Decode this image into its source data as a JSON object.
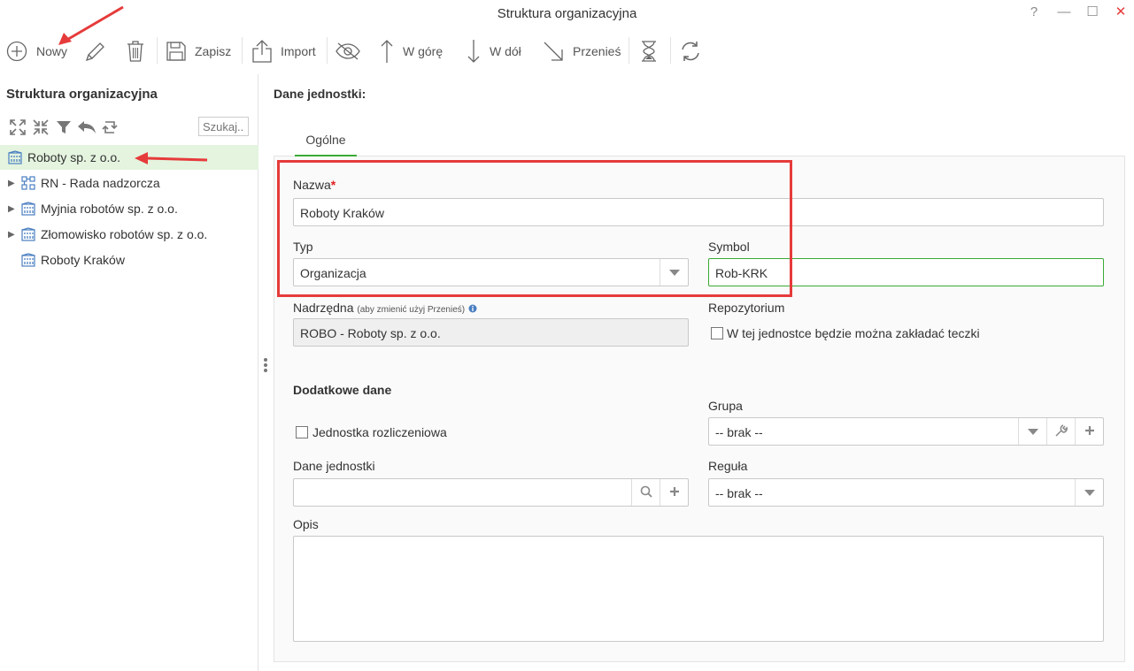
{
  "window": {
    "title": "Struktura organizacyjna",
    "help": "?",
    "minimize": "—",
    "maximize": "☐",
    "close": "✕"
  },
  "toolbar": {
    "new_label": "Nowy",
    "save_label": "Zapisz",
    "import_label": "Import",
    "up_label": "W górę",
    "down_label": "W dół",
    "move_label": "Przenieś"
  },
  "tree": {
    "title": "Struktura organizacyjna",
    "search_placeholder": "Szukaj...",
    "items": [
      {
        "label": "Roboty sp. z o.o.",
        "icon": "building-icon",
        "expandable": false,
        "selected": true
      },
      {
        "label": "RN - Rada nadzorcza",
        "icon": "org-chart-icon",
        "expandable": true
      },
      {
        "label": "Myjnia robotów sp. z o.o.",
        "icon": "building-icon",
        "expandable": true
      },
      {
        "label": "Złomowisko robotów sp. z o.o.",
        "icon": "building-icon",
        "expandable": true
      },
      {
        "label": "Roboty Kraków",
        "icon": "building-icon",
        "expandable": false
      }
    ]
  },
  "form": {
    "title": "Dane jednostki:",
    "tab": "Ogólne",
    "name_label": "Nazwa",
    "name_required": "*",
    "name_value": "Roboty Kraków",
    "type_label": "Typ",
    "type_value": "Organizacja",
    "symbol_label": "Symbol",
    "symbol_value": "Rob-KRK",
    "parent_label": "Nadrzędna",
    "parent_hint": "(aby zmienić użyj Przenieś)",
    "parent_value": "ROBO - Roboty sp. z o.o.",
    "repo_label": "Repozytorium",
    "repo_checkbox": "W tej jednostce będzie można zakładać teczki",
    "extra_title": "Dodatkowe dane",
    "group_label": "Grupa",
    "group_value": "-- brak --",
    "settlement_checkbox": "Jednostka rozliczeniowa",
    "unit_data_label": "Dane jednostki",
    "unit_data_value": "",
    "rule_label": "Reguła",
    "rule_value": "-- brak --",
    "desc_label": "Opis",
    "desc_value": ""
  },
  "colors": {
    "accent": "#3aaa35",
    "selected_bg": "#e4f4df",
    "annotation": "#e63b3b",
    "required": "#e02020",
    "icon_blue": "#4a7fc1"
  }
}
